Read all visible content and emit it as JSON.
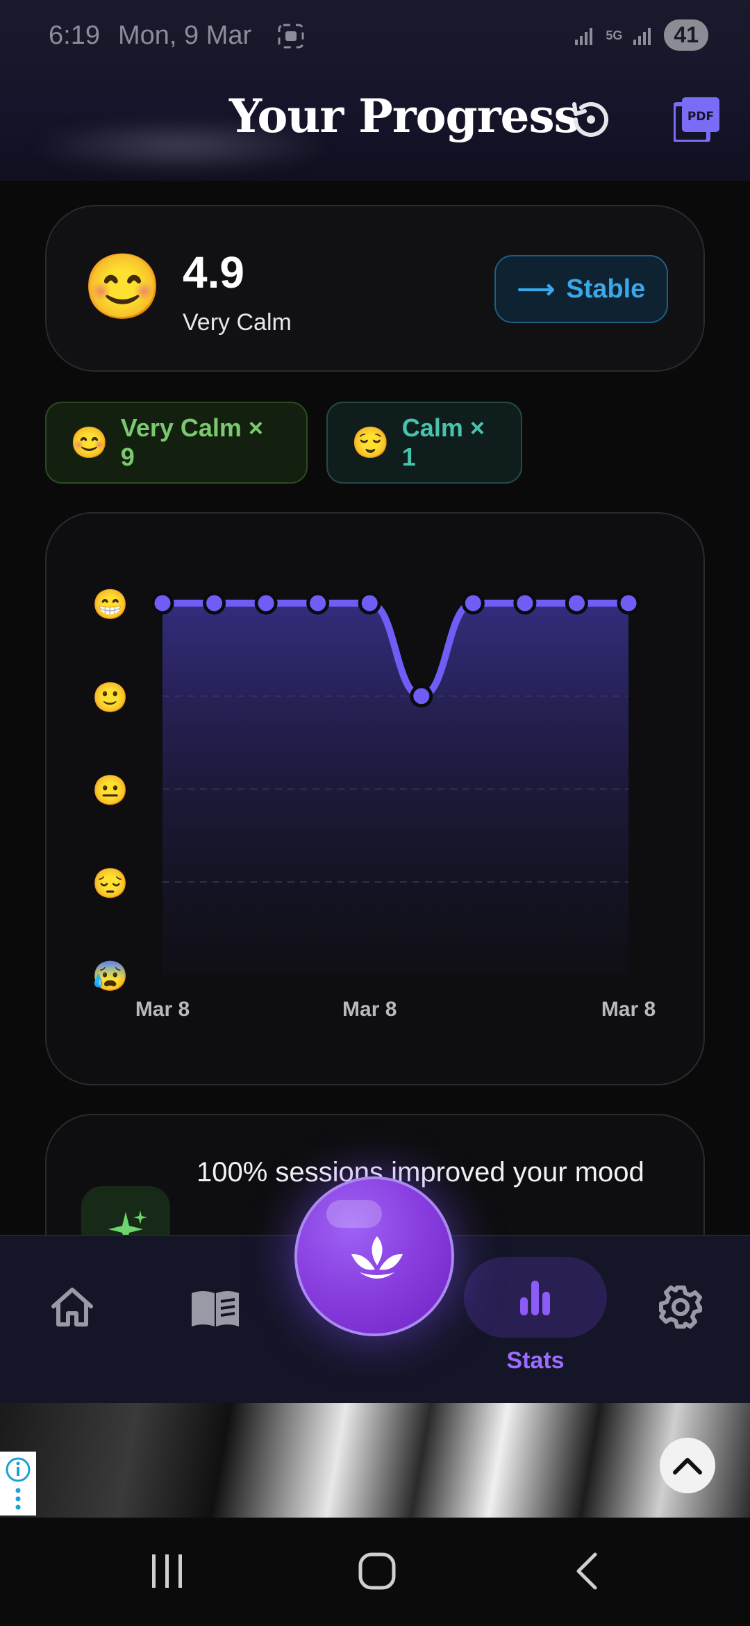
{
  "status_bar": {
    "time": "6:19",
    "date": "Mon, 9 Mar",
    "network": "5G",
    "battery": "41"
  },
  "header": {
    "title": "Your Progress",
    "history_icon": "history-icon",
    "pdf_icon": "pdf-export-icon",
    "pdf_label": "PDF"
  },
  "summary": {
    "emoji": "😊",
    "score": "4.9",
    "label": "Very Calm",
    "trend_arrow": "⟶",
    "trend_label": "Stable"
  },
  "chips": [
    {
      "emoji": "😊",
      "label": "Very Calm × 9"
    },
    {
      "emoji": "😌",
      "label": "Calm × 1"
    }
  ],
  "chart_data": {
    "type": "line",
    "x": [
      1,
      2,
      3,
      4,
      5,
      6,
      7,
      8,
      9,
      10
    ],
    "x_tick_labels": [
      "Mar 8",
      "Mar 8",
      "Mar 8"
    ],
    "values": [
      5,
      5,
      5,
      5,
      5,
      4,
      5,
      5,
      5,
      5
    ],
    "y_tick_emojis": [
      "😁",
      "🙂",
      "😐",
      "😔",
      "😰"
    ],
    "ylim": [
      1,
      5
    ],
    "grid": "dashed horizontal",
    "line_color": "#6f5df5",
    "fill_color": "#3a3290"
  },
  "insight": {
    "icon": "sparkle-icon",
    "text": "100% sessions improved your mood"
  },
  "bottom_nav": {
    "home_icon": "home-icon",
    "library_icon": "book-icon",
    "fab_icon": "lotus-icon",
    "stats_icon": "bar-chart-icon",
    "stats_label": "Stats",
    "settings_icon": "gear-icon"
  },
  "colors": {
    "accent": "#8a3fe0",
    "stable": "#3aa8e8",
    "very_calm": "#7bc96f",
    "calm": "#46c4ae"
  }
}
